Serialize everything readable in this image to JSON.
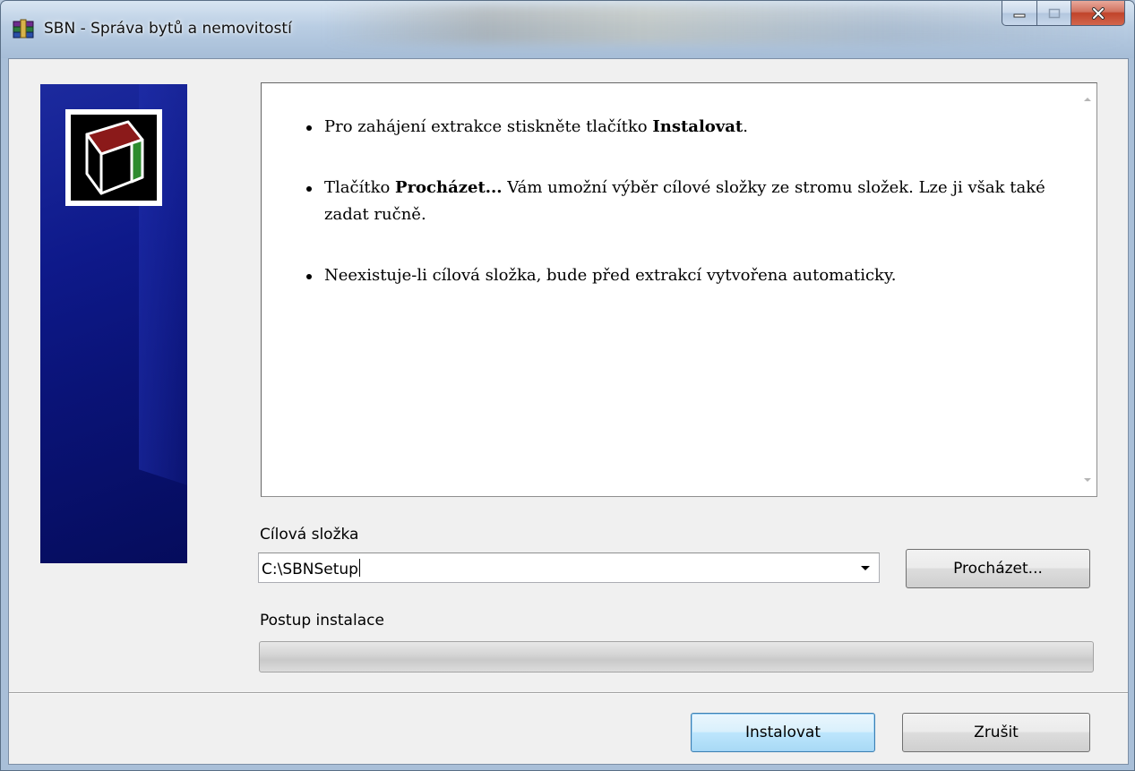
{
  "window": {
    "title": "SBN - Správa bytů a nemovitostí",
    "icon": "winrar-archive-icon"
  },
  "info": {
    "items": [
      {
        "before": "Pro zahájení extrakce stiskněte tlačítko ",
        "bold": "Instalovat",
        "after": "."
      },
      {
        "before": "Tlačítko ",
        "bold": "Procházet...",
        "after": " Vám umožní výběr cílové složky ze stromu složek. Lze ji však také zadat ručně."
      },
      {
        "before": "Neexistuje-li cílová složka, bude před extrakcí vytvořena automaticky.",
        "bold": "",
        "after": ""
      }
    ]
  },
  "target": {
    "label": "Cílová složka",
    "value": "C:\\SBNSetup"
  },
  "progress": {
    "label": "Postup instalace",
    "value": 0
  },
  "buttons": {
    "browse": "Procházet...",
    "install": "Instalovat",
    "cancel": "Zrušit"
  },
  "colors": {
    "banner": "#0a1377",
    "logo_red": "#8b1a1a",
    "logo_green": "#2e8b2e"
  }
}
